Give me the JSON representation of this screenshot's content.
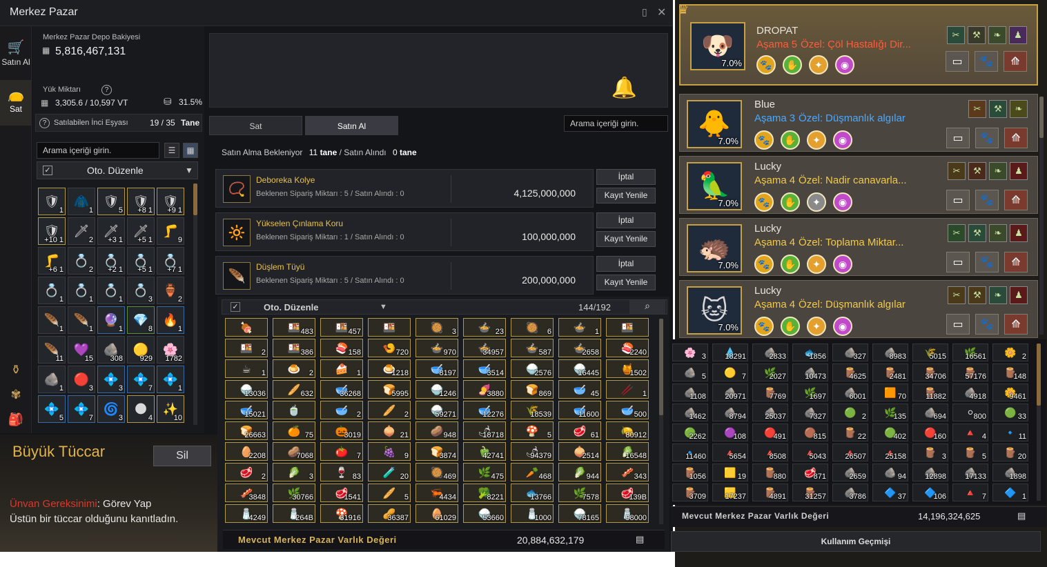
{
  "window": {
    "title": "Merkez Pazar"
  },
  "nav": {
    "buy": "Satın Al",
    "sell": "Sat"
  },
  "balance": {
    "label": "Merkez Pazar Depo Bakiyesi",
    "value": "5,816,467,131"
  },
  "load": {
    "label": "Yük Miktarı",
    "value": "3,305.6 / 10,597 VT",
    "percent": "31.5%"
  },
  "pearl": {
    "label": "Satılabilen İnci Eşyası",
    "value": "19 / 35",
    "unit": "Tane"
  },
  "inventory": {
    "search_placeholder": "Arama içeriği girin.",
    "sort_label": "Oto. Düzenle",
    "slots": [
      {
        "g": "🛡",
        "c": "1",
        "b": "gold"
      },
      {
        "g": "🧥",
        "c": "1",
        "b": ""
      },
      {
        "g": "🛡",
        "c": "5",
        "b": "gold"
      },
      {
        "g": "🛡",
        "c": "+8 1",
        "b": "gold"
      },
      {
        "g": "🛡",
        "c": "+9 1",
        "b": "gold"
      },
      {
        "g": "🛡",
        "c": "+10 1",
        "b": "gold"
      },
      {
        "g": "🗡",
        "c": "2",
        "b": ""
      },
      {
        "g": "🗡",
        "c": "+3 1",
        "b": ""
      },
      {
        "g": "🗡",
        "c": "+5 1",
        "b": ""
      },
      {
        "g": "🦵",
        "c": "9",
        "b": ""
      },
      {
        "g": "🦵",
        "c": "+6 1",
        "b": ""
      },
      {
        "g": "💍",
        "c": "2",
        "b": ""
      },
      {
        "g": "💍",
        "c": "+2 1",
        "b": ""
      },
      {
        "g": "💍",
        "c": "+5 1",
        "b": ""
      },
      {
        "g": "💍",
        "c": "+7 1",
        "b": ""
      },
      {
        "g": "💍",
        "c": "1",
        "b": ""
      },
      {
        "g": "💍",
        "c": "1",
        "b": ""
      },
      {
        "g": "💍",
        "c": "1",
        "b": ""
      },
      {
        "g": "💍",
        "c": "3",
        "b": ""
      },
      {
        "g": "🏺",
        "c": "2",
        "b": ""
      },
      {
        "g": "🪶",
        "c": "1",
        "b": ""
      },
      {
        "g": "🪶",
        "c": "1",
        "b": ""
      },
      {
        "g": "🔮",
        "c": "1",
        "b": "blue"
      },
      {
        "g": "💎",
        "c": "8",
        "b": "green"
      },
      {
        "g": "🔥",
        "c": "1",
        "b": "blue"
      },
      {
        "g": "🪶",
        "c": "11",
        "b": ""
      },
      {
        "g": "💜",
        "c": "15",
        "b": ""
      },
      {
        "g": "🪨",
        "c": "308",
        "b": ""
      },
      {
        "g": "🟡",
        "c": "929",
        "b": ""
      },
      {
        "g": "🌸",
        "c": "1782",
        "b": ""
      },
      {
        "g": "🪨",
        "c": "1",
        "b": ""
      },
      {
        "g": "🔴",
        "c": "3",
        "b": ""
      },
      {
        "g": "💠",
        "c": "3",
        "b": "blue"
      },
      {
        "g": "💠",
        "c": "7",
        "b": "blue"
      },
      {
        "g": "💠",
        "c": "1",
        "b": "blue"
      },
      {
        "g": "💠",
        "c": "5",
        "b": "blue"
      },
      {
        "g": "💠",
        "c": "7",
        "b": "blue"
      },
      {
        "g": "🌀",
        "c": "3",
        "b": "blue"
      },
      {
        "g": "🌑",
        "c": "4",
        "b": "gold"
      },
      {
        "g": "✨",
        "c": "10",
        "b": "gold"
      }
    ]
  },
  "tuccar": {
    "title": "Büyük Tüccar",
    "sil": "Sil",
    "req_label": "Ünvan Gereksinimi",
    "req_value": ": Görev Yap",
    "desc": "Üstün bir tüccar olduğunu kanıtladın."
  },
  "tabs": {
    "sell": "Sat",
    "buy": "Satın Al",
    "search_placeholder": "Arama içeriği girin."
  },
  "orders": {
    "summary_label": "Satın Alma Bekleniyor",
    "waiting": "11",
    "waiting_unit": "tane",
    "received_label": "/ Satın Alındı",
    "received": "0",
    "received_unit": "tane",
    "cancel": "İptal",
    "renew": "Kayıt Yenile",
    "rows": [
      {
        "name": "Deboreka Kolye",
        "sub": "Beklenen Sipariş Miktarı : 5 / Satın Alındı : 0",
        "price": "4,125,000,000",
        "g": "📿"
      },
      {
        "name": "Yükselen Çınlama Koru",
        "sub": "Beklenen Sipariş Miktarı : 1 / Satın Alındı : 0",
        "price": "100,000,000",
        "g": "🔆"
      },
      {
        "name": "Düşlem Tüyü",
        "sub": "Beklenen Sipariş Miktarı : 5 / Satın Alındı : 0",
        "price": "200,000,000",
        "g": "🪶"
      }
    ]
  },
  "bag": {
    "sort_label": "Oto. Düzenle",
    "capacity": "144/192",
    "footer_label": "Mevcut Merkez Pazar Varlık Değeri",
    "footer_value": "20,884,632,179",
    "cells": [
      {
        "g": "🍖",
        "c": ""
      },
      {
        "g": "🍱",
        "c": "483"
      },
      {
        "g": "🍱",
        "c": "457"
      },
      {
        "g": "🍱",
        "c": ""
      },
      {
        "g": "🥘",
        "c": "3"
      },
      {
        "g": "🍲",
        "c": "23"
      },
      {
        "g": "🥘",
        "c": "6"
      },
      {
        "g": "🍲",
        "c": "1"
      },
      {
        "g": "🍱",
        "c": ""
      },
      {
        "g": "🍱",
        "c": "2"
      },
      {
        "g": "🍱",
        "c": "386"
      },
      {
        "g": "🍣",
        "c": "158"
      },
      {
        "g": "🍤",
        "c": "720"
      },
      {
        "g": "🍲",
        "c": "970"
      },
      {
        "g": "🍲",
        "c": "34957"
      },
      {
        "g": "🍲",
        "c": "587"
      },
      {
        "g": "🍲",
        "c": "2658"
      },
      {
        "g": "🍣",
        "c": "2240"
      },
      {
        "g": "☕",
        "c": "1"
      },
      {
        "g": "🍮",
        "c": "2"
      },
      {
        "g": "🍰",
        "c": "1"
      },
      {
        "g": "🍮",
        "c": "1218"
      },
      {
        "g": "🥣",
        "c": "8197"
      },
      {
        "g": "🥣",
        "c": "3514"
      },
      {
        "g": "🍚",
        "c": "2576"
      },
      {
        "g": "🍚",
        "c": "16445"
      },
      {
        "g": "🍯",
        "c": "1502"
      },
      {
        "g": "🍚",
        "c": "13036"
      },
      {
        "g": "🥖",
        "c": "632"
      },
      {
        "g": "🥣",
        "c": "36268"
      },
      {
        "g": "🍞",
        "c": "5995"
      },
      {
        "g": "🍚",
        "c": "1246"
      },
      {
        "g": "🍠",
        "c": "3880"
      },
      {
        "g": "🍞",
        "c": "869"
      },
      {
        "g": "🥣",
        "c": "45"
      },
      {
        "g": "🥢",
        "c": "1"
      },
      {
        "g": "🥣",
        "c": "15021"
      },
      {
        "g": "🍵",
        "c": ""
      },
      {
        "g": "🥣",
        "c": "2"
      },
      {
        "g": "🥖",
        "c": "2"
      },
      {
        "g": "🍚",
        "c": "59271"
      },
      {
        "g": "🥣",
        "c": "12276"
      },
      {
        "g": "🌾",
        "c": "18539"
      },
      {
        "g": "🥣",
        "c": "11600"
      },
      {
        "g": "🥣",
        "c": "500"
      },
      {
        "g": "🍞",
        "c": "26663"
      },
      {
        "g": "🍊",
        "c": "75"
      },
      {
        "g": "🎃",
        "c": "3019"
      },
      {
        "g": "🧅",
        "c": "21"
      },
      {
        "g": "🥔",
        "c": "948"
      },
      {
        "g": "🌶",
        "c": "18718"
      },
      {
        "g": "🍄",
        "c": "5"
      },
      {
        "g": "🥩",
        "c": "61"
      },
      {
        "g": "🍋",
        "c": "80912"
      },
      {
        "g": "🥚",
        "c": "2208"
      },
      {
        "g": "🥔",
        "c": "7068"
      },
      {
        "g": "🍅",
        "c": "7"
      },
      {
        "g": "🍇",
        "c": "9"
      },
      {
        "g": "🍞",
        "c": "3874"
      },
      {
        "g": "🫑",
        "c": "42741"
      },
      {
        "g": "🌶",
        "c": "94379"
      },
      {
        "g": "🧅",
        "c": "2514"
      },
      {
        "g": "🥬",
        "c": "16548"
      },
      {
        "g": "🥩",
        "c": "2"
      },
      {
        "g": "🥬",
        "c": "3"
      },
      {
        "g": "🍷",
        "c": "83"
      },
      {
        "g": "🧪",
        "c": "20"
      },
      {
        "g": "🥘",
        "c": "469"
      },
      {
        "g": "🌿",
        "c": "475"
      },
      {
        "g": "🥕",
        "c": "468"
      },
      {
        "g": "🥬",
        "c": "944"
      },
      {
        "g": "🥓",
        "c": "343"
      },
      {
        "g": "🥓",
        "c": "3848"
      },
      {
        "g": "🌿",
        "c": "30766"
      },
      {
        "g": "🥩",
        "c": "1541"
      },
      {
        "g": "🥖",
        "c": "5"
      },
      {
        "g": "🦐",
        "c": "4434"
      },
      {
        "g": "🥦",
        "c": "8221"
      },
      {
        "g": "🐟",
        "c": "13766"
      },
      {
        "g": "🌿",
        "c": "7578"
      },
      {
        "g": "🥩",
        "c": "139B"
      },
      {
        "g": "🧂",
        "c": "4249"
      },
      {
        "g": "🧂",
        "c": "264B"
      },
      {
        "g": "🍄",
        "c": "31916"
      },
      {
        "g": "🥜",
        "c": "36387"
      },
      {
        "g": "🥚",
        "c": "61029"
      },
      {
        "g": "🍚",
        "c": "53660"
      },
      {
        "g": "🧂",
        "c": "1000"
      },
      {
        "g": "🍚",
        "c": "78165"
      },
      {
        "g": "🧂",
        "c": "98000"
      }
    ]
  },
  "pets": [
    {
      "name": "DROPAT",
      "stage_label": "Aşama",
      "stage": "5",
      "special_label": "Özel:",
      "special": "Çöl Hastalığı Dir...",
      "pct": "7.0%",
      "g": "🐶",
      "stage_color": "#ff5b3a",
      "special_color": "#ff5b3a"
    },
    {
      "name": "Blue",
      "stage_label": "Aşama",
      "stage": "3",
      "special_label": "Özel:",
      "special": "Düşmanlık algılar",
      "pct": "7.0%",
      "g": "🐥",
      "stage_color": "#4aa8ff",
      "special_color": "#4aa8ff"
    },
    {
      "name": "Lucky",
      "stage_label": "Aşama",
      "stage": "4",
      "special_label": "Özel:",
      "special": "Nadir canavarla...",
      "pct": "7.0%",
      "g": "🦜",
      "stage_color": "#f2c94c",
      "special_color": "#f2c94c"
    },
    {
      "name": "Lucky",
      "stage_label": "Aşama",
      "stage": "4",
      "special_label": "Özel:",
      "special": "Toplama Miktar...",
      "pct": "7.0%",
      "g": "🦔",
      "stage_color": "#f2c94c",
      "special_color": "#f2c94c"
    },
    {
      "name": "Lucky",
      "stage_label": "Aşama",
      "stage": "4",
      "special_label": "Özel:",
      "special": "Düşmanlık algılar",
      "pct": "7.0%",
      "g": "🐱",
      "stage_color": "#f2c94c",
      "special_color": "#f2c94c"
    }
  ],
  "rightbag": {
    "footer_label": "Mevcut Merkez Pazar Varlık Değeri",
    "footer_value": "14,196,324,625",
    "history": "Kullanım Geçmişi",
    "cells": [
      {
        "g": "🌸",
        "c": "3"
      },
      {
        "g": "💧",
        "c": "18291"
      },
      {
        "g": "🪨",
        "c": "2833"
      },
      {
        "g": "🐟",
        "c": "1856"
      },
      {
        "g": "🪨",
        "c": "327"
      },
      {
        "g": "🪨",
        "c": "8983"
      },
      {
        "g": "🌾",
        "c": "5015"
      },
      {
        "g": "🌿",
        "c": "16561"
      },
      {
        "g": "🌼",
        "c": "2"
      },
      {
        "g": "🪨",
        "c": "5"
      },
      {
        "g": "🟡",
        "c": "7"
      },
      {
        "g": "🌿",
        "c": "2027"
      },
      {
        "g": "🪨",
        "c": "10473"
      },
      {
        "g": "🪵",
        "c": "4625"
      },
      {
        "g": "🪵",
        "c": "2481"
      },
      {
        "g": "🪵",
        "c": "34706"
      },
      {
        "g": "🪵",
        "c": "57176"
      },
      {
        "g": "🪵",
        "c": "148"
      },
      {
        "g": "🪨",
        "c": "1108"
      },
      {
        "g": "🪨",
        "c": "20971"
      },
      {
        "g": "🪵",
        "c": "7769"
      },
      {
        "g": "🌿",
        "c": "1697"
      },
      {
        "g": "🪨",
        "c": "6001"
      },
      {
        "g": "🟧",
        "c": "70"
      },
      {
        "g": "🪵",
        "c": "11882"
      },
      {
        "g": "🪨",
        "c": "4918"
      },
      {
        "g": "🌼",
        "c": "9461"
      },
      {
        "g": "🪨",
        "c": "1462"
      },
      {
        "g": "🪨",
        "c": "8794"
      },
      {
        "g": "🪨",
        "c": "25037"
      },
      {
        "g": "🪨",
        "c": "7327"
      },
      {
        "g": "🟢",
        "c": "2"
      },
      {
        "g": "🌿",
        "c": "135"
      },
      {
        "g": "🪨",
        "c": "694"
      },
      {
        "g": "⚪",
        "c": "800"
      },
      {
        "g": "🟢",
        "c": "33"
      },
      {
        "g": "🟢",
        "c": "2262"
      },
      {
        "g": "🟣",
        "c": "108"
      },
      {
        "g": "🔴",
        "c": "491"
      },
      {
        "g": "🟤",
        "c": "815"
      },
      {
        "g": "🪵",
        "c": "22"
      },
      {
        "g": "🟢",
        "c": "402"
      },
      {
        "g": "🔴",
        "c": "160"
      },
      {
        "g": "🔺",
        "c": "4"
      },
      {
        "g": "🔹",
        "c": "11"
      },
      {
        "g": "🔹",
        "c": "11460"
      },
      {
        "g": "🔺",
        "c": "5654"
      },
      {
        "g": "🔺",
        "c": "8508"
      },
      {
        "g": "🔺",
        "c": "5043"
      },
      {
        "g": "🔺",
        "c": "26507"
      },
      {
        "g": "🔺",
        "c": "25158"
      },
      {
        "g": "🪵",
        "c": "3"
      },
      {
        "g": "🪵",
        "c": "5"
      },
      {
        "g": "🪵",
        "c": "20"
      },
      {
        "g": "🪵",
        "c": "1056"
      },
      {
        "g": "🟨",
        "c": "19"
      },
      {
        "g": "🪵",
        "c": "880"
      },
      {
        "g": "🥩",
        "c": "871"
      },
      {
        "g": "🪨",
        "c": "2659"
      },
      {
        "g": "🪨",
        "c": "94"
      },
      {
        "g": "🪨",
        "c": "12898"
      },
      {
        "g": "🪨",
        "c": "17133"
      },
      {
        "g": "🪨",
        "c": "1898"
      },
      {
        "g": "🪵",
        "c": "3709"
      },
      {
        "g": "🟨",
        "c": "17237"
      },
      {
        "g": "🪵",
        "c": "4891"
      },
      {
        "g": "🪵",
        "c": "31257"
      },
      {
        "g": "🪨",
        "c": "3786"
      },
      {
        "g": "🔷",
        "c": "37"
      },
      {
        "g": "🔷",
        "c": "106"
      },
      {
        "g": "🔺",
        "c": "7"
      },
      {
        "g": "🔷",
        "c": "1"
      }
    ]
  }
}
